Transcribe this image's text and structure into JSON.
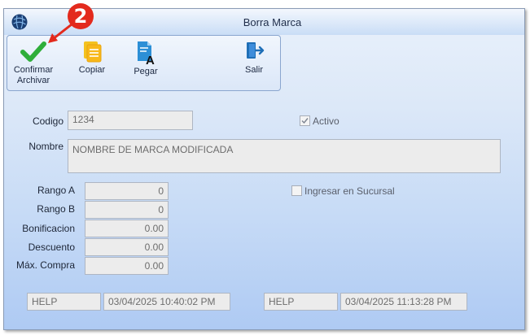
{
  "window": {
    "title": "Borra Marca"
  },
  "annotation": {
    "badge": "2"
  },
  "toolbar": {
    "confirm_line1": "Confirmar",
    "confirm_line2": "Archivar",
    "copy": "Copiar",
    "paste": "Pegar",
    "exit": "Salir"
  },
  "form": {
    "codigo_label": "Codigo",
    "codigo_value": "1234",
    "activo_label": "Activo",
    "activo_checked": true,
    "nombre_label": "Nombre",
    "nombre_value": "NOMBRE DE MARCA MODIFICADA",
    "rango_a_label": "Rango A",
    "rango_a_value": "0",
    "rango_b_label": "Rango B",
    "rango_b_value": "0",
    "bonificacion_label": "Bonificacion",
    "bonificacion_value": "0.00",
    "descuento_label": "Descuento",
    "descuento_value": "0.00",
    "max_compra_label": "Máx. Compra",
    "max_compra_value": "0.00",
    "sucursal_label": "Ingresar en Sucursal",
    "sucursal_checked": false
  },
  "audit": {
    "created_user": "HELP",
    "created_date": "03/04/2025 10:40:02 PM",
    "modified_user": "HELP",
    "modified_date": "03/04/2025 11:13:28 PM"
  },
  "colors": {
    "badge": "#e32a1d",
    "confirm_check": "#2fae3a",
    "accent_blue": "#1f6fb7"
  }
}
